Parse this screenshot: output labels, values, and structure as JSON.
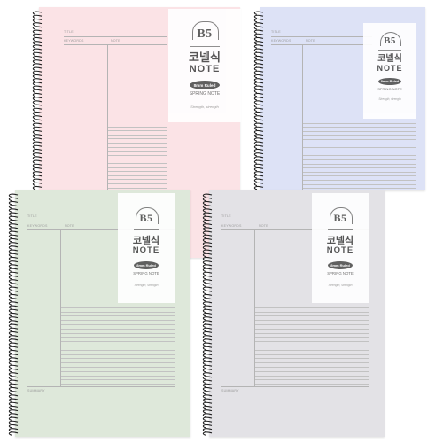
{
  "product": {
    "size_label": "B5",
    "title_korean": "코넬식",
    "title_english": "NOTE",
    "ruling_badge": "8mm Ruled",
    "type_label": "SPRING NOTE",
    "slogan": "Strength, strength"
  },
  "page_labels": {
    "title": "TITLE",
    "keywords": "KEYWORDS",
    "note": "NOTE",
    "summary": "SUMMARY"
  },
  "variants": [
    {
      "name": "pink",
      "cover_color": "#fbe3e6"
    },
    {
      "name": "lavender",
      "cover_color": "#dde2f6"
    },
    {
      "name": "mint",
      "cover_color": "#dee8da"
    },
    {
      "name": "gray",
      "cover_color": "#e3e2e6"
    }
  ]
}
